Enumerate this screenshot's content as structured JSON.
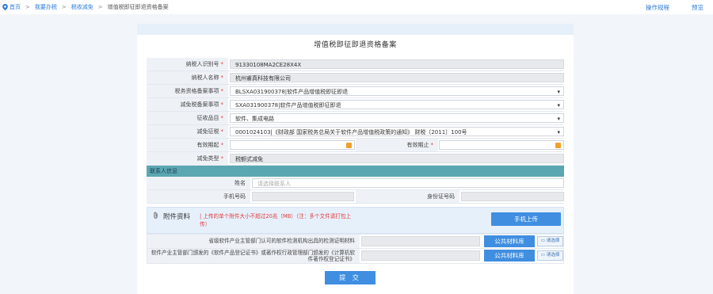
{
  "breadcrumb": {
    "items": [
      "首页",
      "我要办税",
      "税收减免",
      "增值税即征即退资格备案"
    ],
    "separator": ">"
  },
  "top_links": {
    "procedure": "操作规程",
    "preview": "预览"
  },
  "form_title": "增值税即征即退资格备案",
  "fields": {
    "taxpayer_id": {
      "label": "纳税人识别号",
      "value": "91330108MA2CE28X4X"
    },
    "taxpayer_name": {
      "label": "纳税人名称",
      "value": "杭州睿真科技有限公司"
    },
    "tax_filing_item": {
      "label": "税务资格备案事项",
      "value": "BLSXA031900378|软件产品增值税即征即退"
    },
    "exemption_filing_item": {
      "label": "减免税备案事项",
      "value": "SXA031900378|软件产品增值税即征即退"
    },
    "levy_item": {
      "label": "征收品目",
      "value": "软件、集成电路"
    },
    "exemption_clause": {
      "label": "减免征税",
      "value": "0001024103|《财政部 国家税务总局关于软件产品增值税政策的通知》 财税〔2011〕100号"
    },
    "valid_from": {
      "label": "有效期起",
      "value": ""
    },
    "valid_to": {
      "label": "有效期止",
      "value": ""
    },
    "exemption_type": {
      "label": "减免类型",
      "value": "税额式减免"
    }
  },
  "required_mark": "*",
  "contact": {
    "section_title": "联系人信息",
    "name_label": "姓名",
    "name_placeholder": "请选择联系人",
    "phone_label": "手机号码",
    "id_label": "身份证号码"
  },
  "attachments": {
    "title": "附件资料",
    "note": "| 上传的单个附件大小不超过20兆（MB）（注：多个文件请打包上传）",
    "mobile_upload": "手机上传",
    "items": [
      {
        "label": "省级软件产业主管部门认可的软件检测机构出具的检测证明材料",
        "public_btn": "公共材料库",
        "choose_btn": "请选择"
      },
      {
        "label": "软件产业主管部门颁发的《软件产品登记证书》或著作权行政管理部门颁发的《计算机软件著作权登记证书》",
        "public_btn": "公共材料库",
        "choose_btn": "请选择"
      }
    ]
  },
  "submit_label": "提 交",
  "colors": {
    "accent": "#3f8ee0",
    "section": "#5aa7b2",
    "required": "#e03b3b",
    "date_icon": "#f0a12c"
  }
}
